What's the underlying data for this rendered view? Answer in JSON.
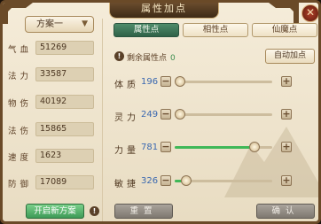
{
  "window": {
    "title": "属性加点",
    "close_symbol": "✕"
  },
  "scheme": {
    "selected": "方案一"
  },
  "base_stats": [
    {
      "name": "气血",
      "value": "51269"
    },
    {
      "name": "法力",
      "value": "33587"
    },
    {
      "name": "物伤",
      "value": "40192"
    },
    {
      "name": "法伤",
      "value": "15865"
    },
    {
      "name": "速度",
      "value": "1623"
    },
    {
      "name": "防御",
      "value": "17089"
    }
  ],
  "open_scheme_button": "开启新方案",
  "info_symbol": "!",
  "tabs": [
    {
      "label": "属性点",
      "active": true
    },
    {
      "label": "相性点",
      "active": false
    },
    {
      "label": "仙魔点",
      "active": false
    }
  ],
  "remaining": {
    "label": "剩余属性点",
    "value": "0"
  },
  "auto_button": "自动加点",
  "attributes": [
    {
      "name": "体质",
      "value": "196",
      "level": 0.0
    },
    {
      "name": "灵力",
      "value": "249",
      "level": 0.0
    },
    {
      "name": "力量",
      "value": "781",
      "level": 0.82
    },
    {
      "name": "敏捷",
      "value": "326",
      "level": 0.12
    }
  ],
  "reset_button": "重置",
  "confirm_button": "确认",
  "colors": {
    "accent_green": "#3fb857",
    "tab_active": "#2f6147",
    "value_blue": "#3a68b0"
  }
}
